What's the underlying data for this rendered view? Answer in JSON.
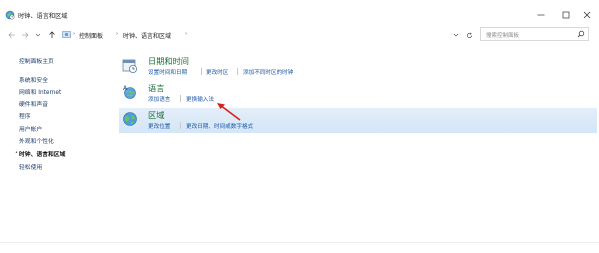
{
  "window": {
    "title": "时钟、语言和区域"
  },
  "nav": {
    "breadcrumb": [
      "控制面板",
      "时钟、语言和区域"
    ],
    "search_placeholder": "搜索控制面板"
  },
  "sidebar": {
    "items": [
      {
        "label": "控制面板主页"
      },
      {
        "label": "系统和安全"
      },
      {
        "label": "网络和 Internet"
      },
      {
        "label": "硬件和声音"
      },
      {
        "label": "程序"
      },
      {
        "label": "用户帐户"
      },
      {
        "label": "外观和个性化"
      },
      {
        "label": "时钟、语言和区域"
      },
      {
        "label": "轻松使用"
      }
    ]
  },
  "categories": [
    {
      "title": "日期和时间",
      "links": [
        "设置时间和日期",
        "更改时区",
        "添加不同时区的时钟"
      ]
    },
    {
      "title": "语言",
      "links": [
        "添加语言",
        "更换输入法"
      ]
    },
    {
      "title": "区域",
      "links": [
        "更改位置",
        "更改日期、时间或数字格式"
      ]
    }
  ],
  "colors": {
    "category_title": "#1a6c37",
    "link": "#1c57a5",
    "highlight": "#d9e8f7",
    "annotation_arrow": "#d81e1e"
  }
}
